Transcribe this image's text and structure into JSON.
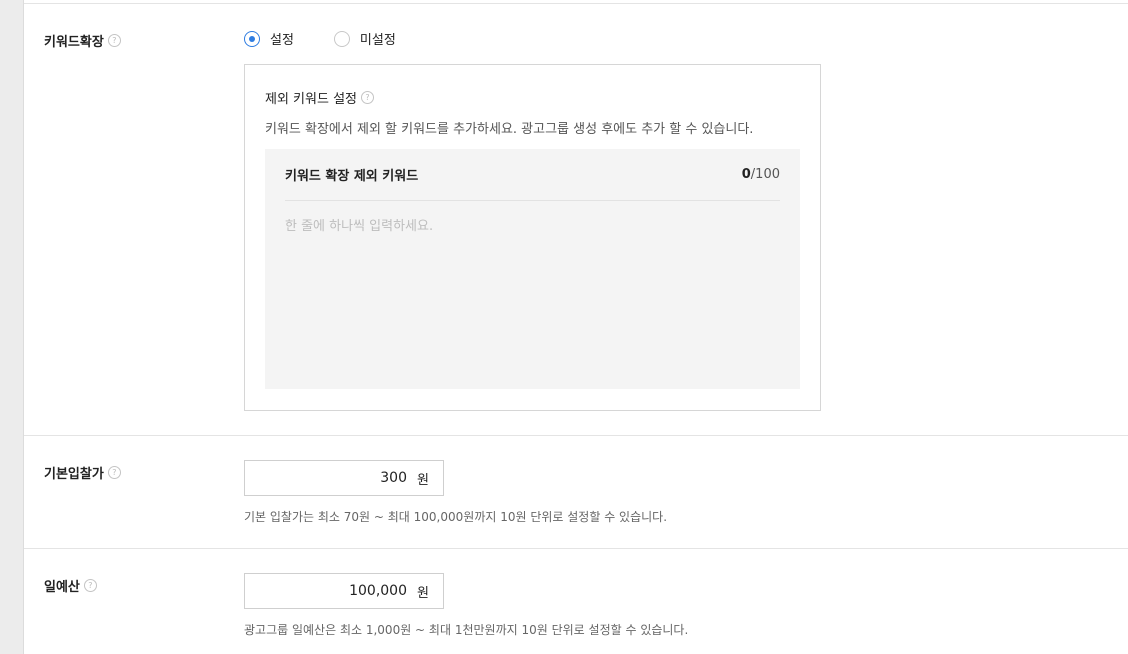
{
  "keyword_expansion": {
    "label": "키워드확장",
    "options": [
      {
        "label": "설정",
        "checked": true
      },
      {
        "label": "미설정",
        "checked": false
      }
    ]
  },
  "exclude_keywords": {
    "title": "제외 키워드 설정",
    "description": "키워드 확장에서 제외 할 키워드를 추가하세요. 광고그룹 생성 후에도 추가 할 수 있습니다.",
    "list_title": "키워드 확장 제외 키워드",
    "count_current": "0",
    "count_max": "/100",
    "placeholder": "한 줄에 하나씩 입력하세요."
  },
  "base_bid": {
    "label": "기본입찰가",
    "value": "300",
    "unit": "원",
    "hint": "기본 입찰가는 최소 70원 ~ 최대 100,000원까지 10원 단위로 설정할 수 있습니다."
  },
  "daily_budget": {
    "label": "일예산",
    "value": "100,000",
    "unit": "원",
    "hint": "광고그룹 일예산은 최소 1,000원 ~ 최대 1천만원까지 10원 단위로 설정할 수 있습니다."
  },
  "icons": {
    "help": "help-icon",
    "help_glyph": "?"
  },
  "colors": {
    "accent": "#2f7de1",
    "gutter": "#ececec",
    "keyword_area": "#f4f4f4"
  }
}
